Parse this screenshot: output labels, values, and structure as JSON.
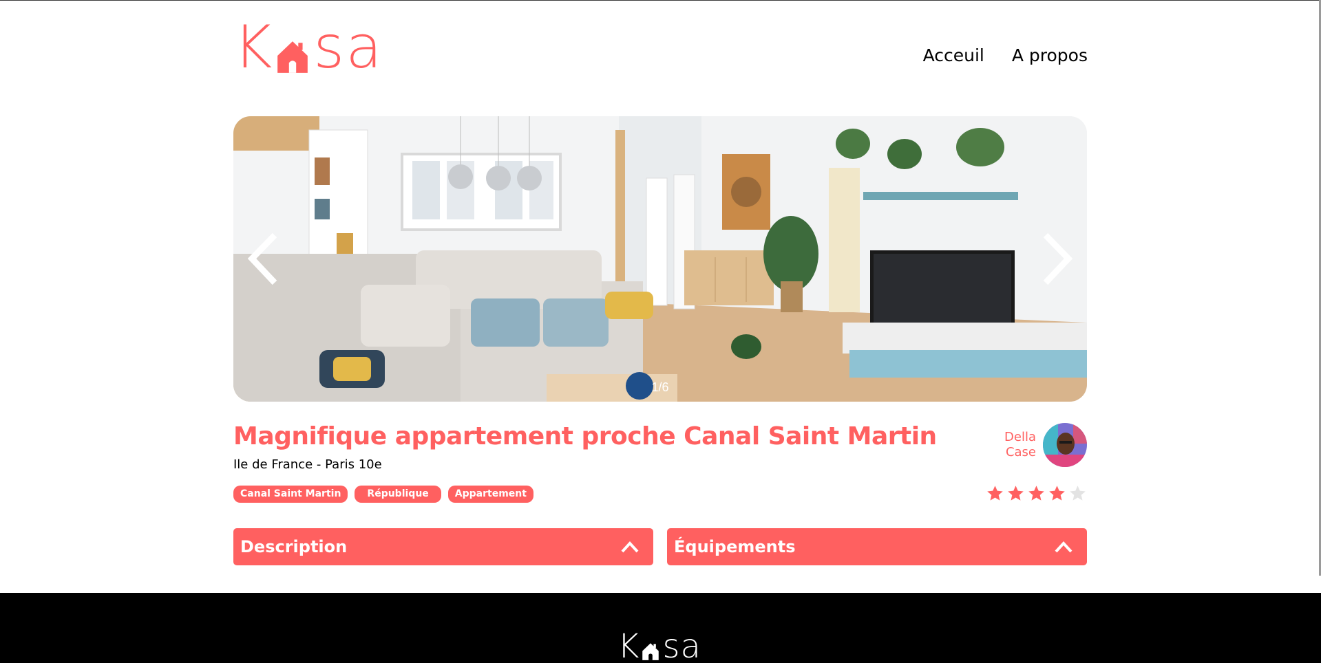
{
  "brand": {
    "logo_left": "K",
    "logo_right": "sa",
    "logo_color": "#FF6060",
    "house_icon": "house-icon"
  },
  "nav": {
    "home_label": "Acceuil",
    "about_label": "A propos"
  },
  "carousel": {
    "counter": "1/6",
    "prev_icon": "chevron-left-icon",
    "next_icon": "chevron-right-icon"
  },
  "listing": {
    "title": "Magnifique appartement proche Canal Saint Martin",
    "location": "Ile de France - Paris 10e",
    "tags": [
      "Canal Saint Martin",
      "République",
      "Appartement"
    ],
    "host": {
      "first_name": "Della",
      "last_name": "Case"
    },
    "rating": 4,
    "rating_max": 5
  },
  "collapses": {
    "description_label": "Description",
    "equipment_label": "Équipements",
    "toggle_icon": "chevron-up-icon"
  },
  "colors": {
    "accent": "#FF6060",
    "star_empty": "#E3E3E3",
    "footer_bg": "#000000"
  }
}
